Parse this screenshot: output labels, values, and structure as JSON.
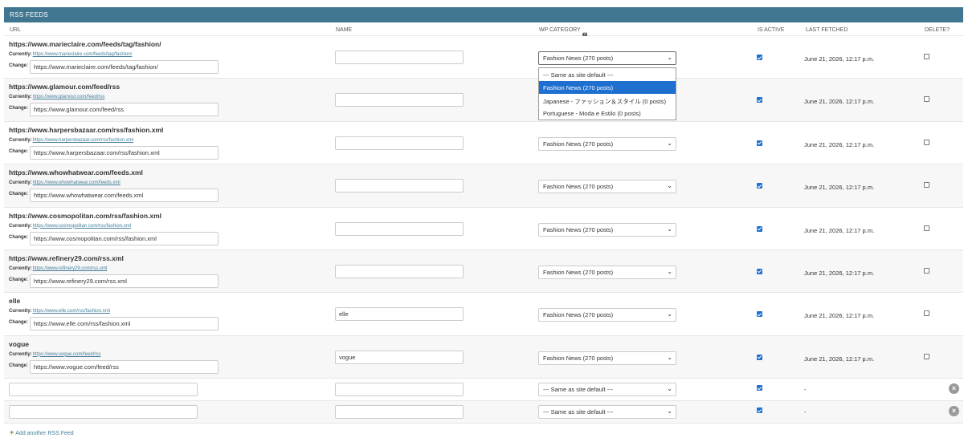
{
  "caption": "RSS FEEDS",
  "headers": {
    "url": "URL",
    "name": "NAME",
    "wp_category": "WP CATEGORY",
    "is_active": "IS ACTIVE",
    "last_fetched": "LAST FETCHED",
    "delete": "DELETE?"
  },
  "labels": {
    "currently": "Currently:",
    "change": "Change:"
  },
  "rows": [
    {
      "title": "https://www.marieclaire.com/feeds/tag/fashion/",
      "currently": "https://www.marieclaire.com/feeds/tag/fashion/",
      "change": "https://www.marieclaire.com/feeds/tag/fashion/",
      "name": "",
      "category": "Fashion News (270 posts)",
      "active": true,
      "fetched": "June 21, 2026, 12:17 p.m.",
      "delete": false
    },
    {
      "title": "https://www.glamour.com/feed/rss",
      "currently": "https://www.glamour.com/feed/rss",
      "change": "https://www.glamour.com/feed/rss",
      "name": "",
      "category": "Fashion News (270 posts)",
      "active": true,
      "fetched": "June 21, 2026, 12:17 p.m.",
      "delete": false
    },
    {
      "title": "https://www.harpersbazaar.com/rss/fashion.xml",
      "currently": "https://www.harpersbazaar.com/rss/fashion.xml",
      "change": "https://www.harpersbazaar.com/rss/fashion.xml",
      "name": "",
      "category": "Fashion News (270 posts)",
      "active": true,
      "fetched": "June 21, 2026, 12:17 p.m.",
      "delete": false
    },
    {
      "title": "https://www.whowhatwear.com/feeds.xml",
      "currently": "https://www.whowhatwear.com/feeds.xml",
      "change": "https://www.whowhatwear.com/feeds.xml",
      "name": "",
      "category": "Fashion News (270 posts)",
      "active": true,
      "fetched": "June 21, 2026, 12:17 p.m.",
      "delete": false
    },
    {
      "title": "https://www.cosmopolitan.com/rss/fashion.xml",
      "currently": "https://www.cosmopolitan.com/rss/fashion.xml",
      "change": "https://www.cosmopolitan.com/rss/fashion.xml",
      "name": "",
      "category": "Fashion News (270 posts)",
      "active": true,
      "fetched": "June 21, 2026, 12:17 p.m.",
      "delete": false
    },
    {
      "title": "https://www.refinery29.com/rss.xml",
      "currently": "https://www.refinery29.com/rss.xml",
      "change": "https://www.refinery29.com/rss.xml",
      "name": "",
      "category": "Fashion News (270 posts)",
      "active": true,
      "fetched": "June 21, 2026, 12:17 p.m.",
      "delete": false
    },
    {
      "title": "elle",
      "currently": "https://www.elle.com/rss/fashion.xml",
      "change": "https://www.elle.com/rss/fashion.xml",
      "name": "elle",
      "category": "Fashion News (270 posts)",
      "active": true,
      "fetched": "June 21, 2026, 12:17 p.m.",
      "delete": false
    },
    {
      "title": "vogue",
      "currently": "https://www.vogue.com/feed/rss",
      "change": "https://www.vogue.com/feed/rss",
      "name": "vogue",
      "category": "Fashion News (270 posts)",
      "active": true,
      "fetched": "June 21, 2026, 12:17 p.m.",
      "delete": false
    }
  ],
  "extra_rows": [
    {
      "url": "",
      "name": "",
      "category": "--- Same as site default ---",
      "active": true,
      "fetched": "-"
    },
    {
      "url": "",
      "name": "",
      "category": "--- Same as site default ---",
      "active": true,
      "fetched": "-"
    }
  ],
  "dropdown_options": [
    {
      "label": "--- Same as site default ---",
      "selected": false
    },
    {
      "label": "Fashion News (270 posts)",
      "selected": true
    },
    {
      "label": "Japanese - ファッション＆スタイル (0 posts)",
      "selected": false
    },
    {
      "label": "Portuguese - Moda e Estilo (0 posts)",
      "selected": false
    }
  ],
  "add_link": "Add another RSS Feed",
  "icons": {
    "help": "question-circle-icon",
    "chevron": "chevron-down-icon",
    "remove": "remove-x-icon",
    "add": "plus-icon"
  },
  "colors": {
    "caption_bg": "#417690",
    "link": "#447e9b",
    "checkbox": "#1e6fd0",
    "add_plus": "#5b9b2e"
  }
}
